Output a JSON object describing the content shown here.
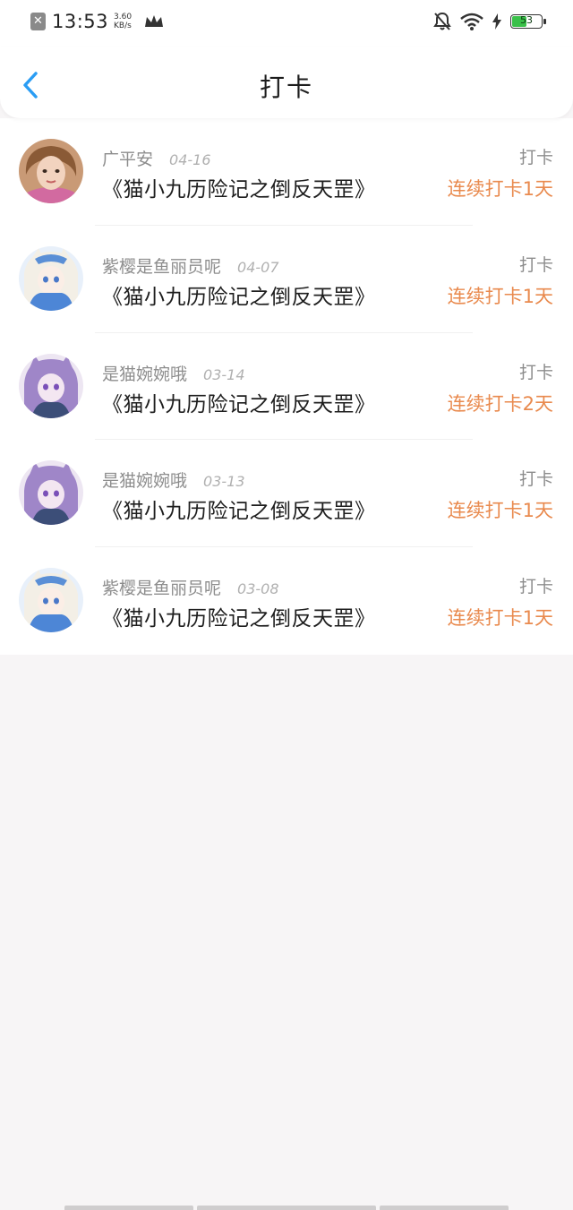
{
  "status_bar": {
    "time": "13:53",
    "speed_value": "3.60",
    "speed_unit": "KB/s",
    "battery": "53",
    "battery_level": 0.53
  },
  "header": {
    "title": "打卡"
  },
  "entries": [
    {
      "user": "广平安",
      "date": "04-16",
      "title": "《猫小九历险记之倒反天罡》",
      "action": "打卡",
      "streak": "连续打卡1天"
    },
    {
      "user": "紫樱是鱼丽员呢",
      "date": "04-07",
      "title": "《猫小九历险记之倒反天罡》",
      "action": "打卡",
      "streak": "连续打卡1天"
    },
    {
      "user": "是猫婉婉哦",
      "date": "03-14",
      "title": "《猫小九历险记之倒反天罡》",
      "action": "打卡",
      "streak": "连续打卡2天"
    },
    {
      "user": "是猫婉婉哦",
      "date": "03-13",
      "title": "《猫小九历险记之倒反天罡》",
      "action": "打卡",
      "streak": "连续打卡1天"
    },
    {
      "user": "紫樱是鱼丽员呢",
      "date": "03-08",
      "title": "《猫小九历险记之倒反天罡》",
      "action": "打卡",
      "streak": "连续打卡1天"
    }
  ],
  "colors": {
    "accent_blue": "#2a9df4",
    "streak_orange": "#e98a4e"
  }
}
